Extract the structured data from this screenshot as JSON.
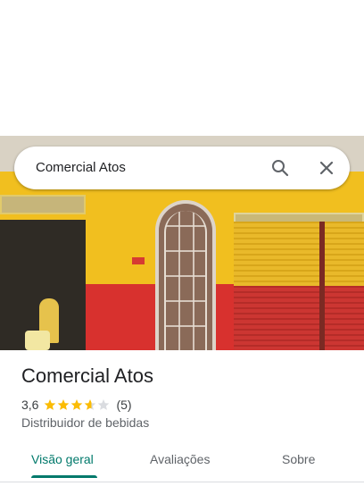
{
  "search": {
    "query": "Comercial Atos"
  },
  "place": {
    "name": "Comercial Atos",
    "rating": "3,6",
    "rating_value": 3.6,
    "stars_max": 5,
    "review_count": "(5)",
    "category": "Distribuidor de bebidas"
  },
  "tabs": [
    {
      "label": "Visão geral",
      "active": true
    },
    {
      "label": "Avaliações",
      "active": false
    },
    {
      "label": "Sobre",
      "active": false
    }
  ],
  "icons": {
    "search": "search-icon",
    "close": "close-icon",
    "star": "star-icon"
  },
  "colors": {
    "accent": "#00796b",
    "star_filled": "#fbbc04",
    "star_empty": "#dadce0",
    "text_primary": "#202124",
    "text_secondary": "#5f6368"
  }
}
